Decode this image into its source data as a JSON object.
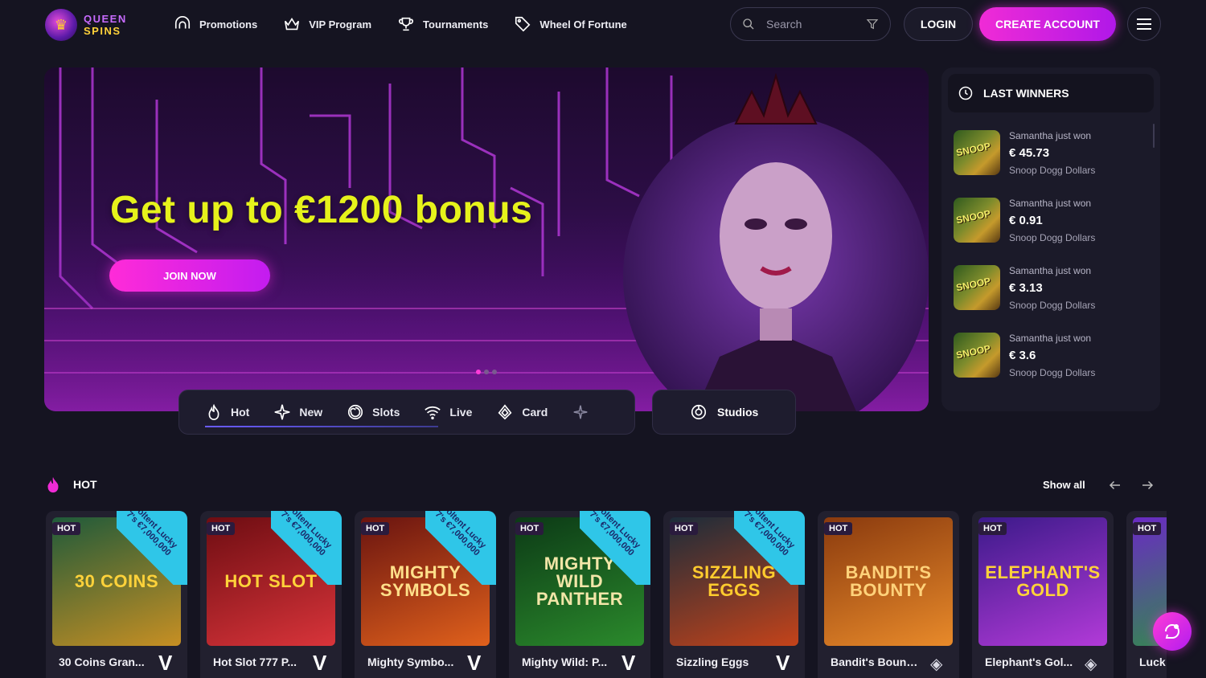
{
  "brand": {
    "line1": "QUEEN",
    "line2": "SPINS"
  },
  "nav": [
    {
      "label": "Promotions"
    },
    {
      "label": "VIP Program"
    },
    {
      "label": "Tournaments"
    },
    {
      "label": "Wheel Of Fortune"
    }
  ],
  "search": {
    "placeholder": "Search"
  },
  "auth": {
    "login": "LOGIN",
    "create": "CREATE ACCOUNT"
  },
  "hero": {
    "title": "Get up to €1200 bonus",
    "cta": "JOIN NOW",
    "slides": 3,
    "active_slide": 1
  },
  "categories": [
    {
      "label": "Hot"
    },
    {
      "label": "New"
    },
    {
      "label": "Slots"
    },
    {
      "label": "Live"
    },
    {
      "label": "Card"
    }
  ],
  "studios": {
    "label": "Studios"
  },
  "winners": {
    "title": "LAST WINNERS",
    "thumb_text": "SNOOP",
    "items": [
      {
        "who": "Samantha just won",
        "amount": "€ 45.73",
        "game": "Snoop Dogg Dollars"
      },
      {
        "who": "Samantha just won",
        "amount": "€ 0.91",
        "game": "Snoop Dogg Dollars"
      },
      {
        "who": "Samantha just won",
        "amount": "€ 3.13",
        "game": "Snoop Dogg Dollars"
      },
      {
        "who": "Samantha just won",
        "amount": "€ 3.6",
        "game": "Snoop Dogg Dollars"
      }
    ]
  },
  "hot_section": {
    "title": "HOT",
    "show_all": "Show all"
  },
  "games": [
    {
      "badge": "HOT",
      "name": "30 Coins Gran...",
      "art": "30 COINS",
      "ribbon": "Voltent Lucky 7's €7,000,000",
      "provider": "V",
      "color_a": "#1f5a3a",
      "color_b": "#c78f23",
      "art_color": "#ffd23a"
    },
    {
      "badge": "HOT",
      "name": "Hot Slot 777 P...",
      "art": "HOT SLOT",
      "ribbon": "Voltent Lucky 7's €7,000,000",
      "provider": "V",
      "color_a": "#6e0d12",
      "color_b": "#d8343a",
      "art_color": "#ffd23a"
    },
    {
      "badge": "HOT",
      "name": "Mighty Symbo...",
      "art": "MIGHTY SYMBOLS",
      "ribbon": "Voltent Lucky 7's €7,000,000",
      "provider": "V",
      "color_a": "#6a1410",
      "color_b": "#e0611c",
      "art_color": "#ffe08a"
    },
    {
      "badge": "HOT",
      "name": "Mighty Wild: P...",
      "art": "MIGHTY WILD PANTHER",
      "ribbon": "Voltent Lucky 7's €7,000,000",
      "provider": "V",
      "color_a": "#0c3a16",
      "color_b": "#2b8a2c",
      "art_color": "#f2e6a8"
    },
    {
      "badge": "HOT",
      "name": "Sizzling Eggs",
      "art": "SIZZLING EGGS",
      "ribbon": "Voltent Lucky 7's €7,000,000",
      "provider": "V",
      "color_a": "#1c2c3a",
      "color_b": "#c4431a",
      "art_color": "#ffcc2e"
    },
    {
      "badge": "HOT",
      "name": "Bandit's Bount...",
      "art": "BANDIT'S BOUNTY",
      "ribbon": "",
      "provider": "◈",
      "color_a": "#8a3a0e",
      "color_b": "#e88a2a",
      "art_color": "#ffd27a"
    },
    {
      "badge": "HOT",
      "name": "Elephant's Gol...",
      "art": "ELEPHANT'S GOLD",
      "ribbon": "",
      "provider": "◈",
      "color_a": "#3c1a8a",
      "color_b": "#b23ad8",
      "art_color": "#ffd23a"
    },
    {
      "badge": "HOT",
      "name": "Luck",
      "art": "",
      "ribbon": "",
      "provider": "",
      "color_a": "#6a2ac4",
      "color_b": "#2a9a3a",
      "art_color": "#ffffff"
    }
  ],
  "colors": {
    "accent": "#f02bd6",
    "hero_title": "#e6f21b",
    "bg": "#151421"
  }
}
